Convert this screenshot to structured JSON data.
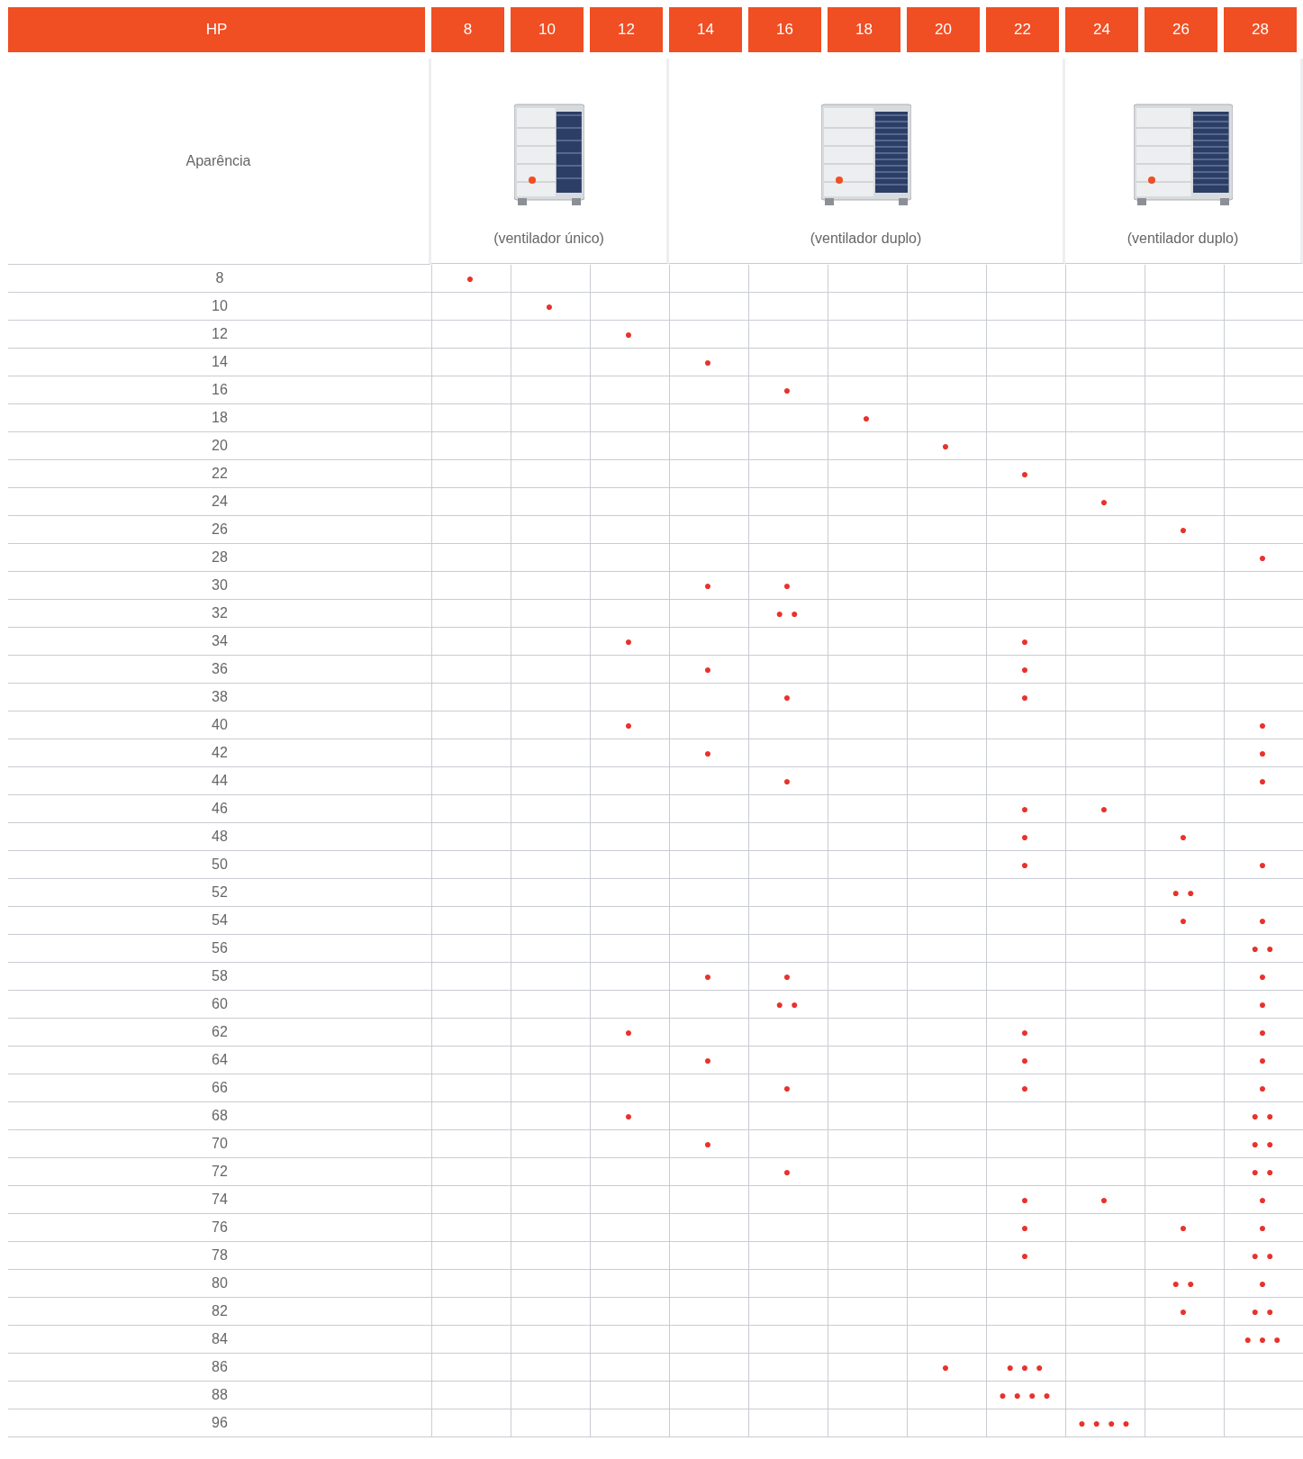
{
  "header": {
    "label": "HP",
    "columns": [
      "8",
      "10",
      "12",
      "14",
      "16",
      "18",
      "20",
      "22",
      "24",
      "26",
      "28"
    ]
  },
  "appearance": {
    "label": "Aparência",
    "groups": [
      {
        "caption": "(ventilador único)",
        "kind": "single"
      },
      {
        "caption": "(ventilador duplo)",
        "kind": "double"
      },
      {
        "caption": "(ventilador duplo)",
        "kind": "wide"
      }
    ]
  },
  "rows": [
    {
      "hp": "8",
      "cells": [
        "●",
        null,
        null,
        null,
        null,
        null,
        null,
        null,
        null,
        null,
        null
      ]
    },
    {
      "hp": "10",
      "cells": [
        null,
        "●",
        null,
        null,
        null,
        null,
        null,
        null,
        null,
        null,
        null
      ]
    },
    {
      "hp": "12",
      "cells": [
        null,
        null,
        "●",
        null,
        null,
        null,
        null,
        null,
        null,
        null,
        null
      ]
    },
    {
      "hp": "14",
      "cells": [
        null,
        null,
        null,
        "●",
        null,
        null,
        null,
        null,
        null,
        null,
        null
      ]
    },
    {
      "hp": "16",
      "cells": [
        null,
        null,
        null,
        null,
        "●",
        null,
        null,
        null,
        null,
        null,
        null
      ]
    },
    {
      "hp": "18",
      "cells": [
        null,
        null,
        null,
        null,
        null,
        "●",
        null,
        null,
        null,
        null,
        null
      ]
    },
    {
      "hp": "20",
      "cells": [
        null,
        null,
        null,
        null,
        null,
        null,
        "●",
        null,
        null,
        null,
        null
      ]
    },
    {
      "hp": "22",
      "cells": [
        null,
        null,
        null,
        null,
        null,
        null,
        null,
        "●",
        null,
        null,
        null
      ]
    },
    {
      "hp": "24",
      "cells": [
        null,
        null,
        null,
        null,
        null,
        null,
        null,
        null,
        "●",
        null,
        null
      ]
    },
    {
      "hp": "26",
      "cells": [
        null,
        null,
        null,
        null,
        null,
        null,
        null,
        null,
        null,
        "●",
        null
      ]
    },
    {
      "hp": "28",
      "cells": [
        null,
        null,
        null,
        null,
        null,
        null,
        null,
        null,
        null,
        null,
        "●"
      ]
    },
    {
      "hp": "30",
      "cells": [
        null,
        null,
        null,
        "●",
        "●",
        null,
        null,
        null,
        null,
        null,
        null
      ]
    },
    {
      "hp": "32",
      "cells": [
        null,
        null,
        null,
        null,
        "● ●",
        null,
        null,
        null,
        null,
        null,
        null
      ]
    },
    {
      "hp": "34",
      "cells": [
        null,
        null,
        "●",
        null,
        null,
        null,
        null,
        "●",
        null,
        null,
        null
      ]
    },
    {
      "hp": "36",
      "cells": [
        null,
        null,
        null,
        "●",
        null,
        null,
        null,
        "●",
        null,
        null,
        null
      ]
    },
    {
      "hp": "38",
      "cells": [
        null,
        null,
        null,
        null,
        "●",
        null,
        null,
        "●",
        null,
        null,
        null
      ]
    },
    {
      "hp": "40",
      "cells": [
        null,
        null,
        "●",
        null,
        null,
        null,
        null,
        null,
        null,
        null,
        "●"
      ]
    },
    {
      "hp": "42",
      "cells": [
        null,
        null,
        null,
        "●",
        null,
        null,
        null,
        null,
        null,
        null,
        "●"
      ]
    },
    {
      "hp": "44",
      "cells": [
        null,
        null,
        null,
        null,
        "●",
        null,
        null,
        null,
        null,
        null,
        "●"
      ]
    },
    {
      "hp": "46",
      "cells": [
        null,
        null,
        null,
        null,
        null,
        null,
        null,
        "●",
        "●",
        null,
        null
      ]
    },
    {
      "hp": "48",
      "cells": [
        null,
        null,
        null,
        null,
        null,
        null,
        null,
        "●",
        null,
        "●",
        null
      ]
    },
    {
      "hp": "50",
      "cells": [
        null,
        null,
        null,
        null,
        null,
        null,
        null,
        "●",
        null,
        null,
        "●"
      ]
    },
    {
      "hp": "52",
      "cells": [
        null,
        null,
        null,
        null,
        null,
        null,
        null,
        null,
        null,
        "● ●",
        null
      ]
    },
    {
      "hp": "54",
      "cells": [
        null,
        null,
        null,
        null,
        null,
        null,
        null,
        null,
        null,
        "●",
        "●"
      ]
    },
    {
      "hp": "56",
      "cells": [
        null,
        null,
        null,
        null,
        null,
        null,
        null,
        null,
        null,
        null,
        "● ●"
      ]
    },
    {
      "hp": "58",
      "cells": [
        null,
        null,
        null,
        "●",
        "●",
        null,
        null,
        null,
        null,
        null,
        "●"
      ]
    },
    {
      "hp": "60",
      "cells": [
        null,
        null,
        null,
        null,
        "● ●",
        null,
        null,
        null,
        null,
        null,
        "●"
      ]
    },
    {
      "hp": "62",
      "cells": [
        null,
        null,
        "●",
        null,
        null,
        null,
        null,
        "●",
        null,
        null,
        "●"
      ]
    },
    {
      "hp": "64",
      "cells": [
        null,
        null,
        null,
        "●",
        null,
        null,
        null,
        "●",
        null,
        null,
        "●"
      ]
    },
    {
      "hp": "66",
      "cells": [
        null,
        null,
        null,
        null,
        "●",
        null,
        null,
        "●",
        null,
        null,
        "●"
      ]
    },
    {
      "hp": "68",
      "cells": [
        null,
        null,
        "●",
        null,
        null,
        null,
        null,
        null,
        null,
        null,
        "● ●"
      ]
    },
    {
      "hp": "70",
      "cells": [
        null,
        null,
        null,
        "●",
        null,
        null,
        null,
        null,
        null,
        null,
        "● ●"
      ]
    },
    {
      "hp": "72",
      "cells": [
        null,
        null,
        null,
        null,
        "●",
        null,
        null,
        null,
        null,
        null,
        "● ●"
      ]
    },
    {
      "hp": "74",
      "cells": [
        null,
        null,
        null,
        null,
        null,
        null,
        null,
        "●",
        "●",
        null,
        "●"
      ]
    },
    {
      "hp": "76",
      "cells": [
        null,
        null,
        null,
        null,
        null,
        null,
        null,
        "●",
        null,
        "●",
        "●"
      ]
    },
    {
      "hp": "78",
      "cells": [
        null,
        null,
        null,
        null,
        null,
        null,
        null,
        "●",
        null,
        null,
        "● ●"
      ]
    },
    {
      "hp": "80",
      "cells": [
        null,
        null,
        null,
        null,
        null,
        null,
        null,
        null,
        null,
        "● ●",
        "●"
      ]
    },
    {
      "hp": "82",
      "cells": [
        null,
        null,
        null,
        null,
        null,
        null,
        null,
        null,
        null,
        "●",
        "● ●"
      ]
    },
    {
      "hp": "84",
      "cells": [
        null,
        null,
        null,
        null,
        null,
        null,
        null,
        null,
        null,
        null,
        "● ● ●"
      ]
    },
    {
      "hp": "86",
      "cells": [
        null,
        null,
        null,
        null,
        null,
        null,
        "●",
        "● ● ●",
        null,
        null,
        null
      ]
    },
    {
      "hp": "88",
      "cells": [
        null,
        null,
        null,
        null,
        null,
        null,
        null,
        "● ● ● ●",
        null,
        null,
        null
      ]
    },
    {
      "hp": "96",
      "cells": [
        null,
        null,
        null,
        null,
        null,
        null,
        null,
        null,
        "● ● ● ●",
        null,
        null
      ]
    }
  ]
}
